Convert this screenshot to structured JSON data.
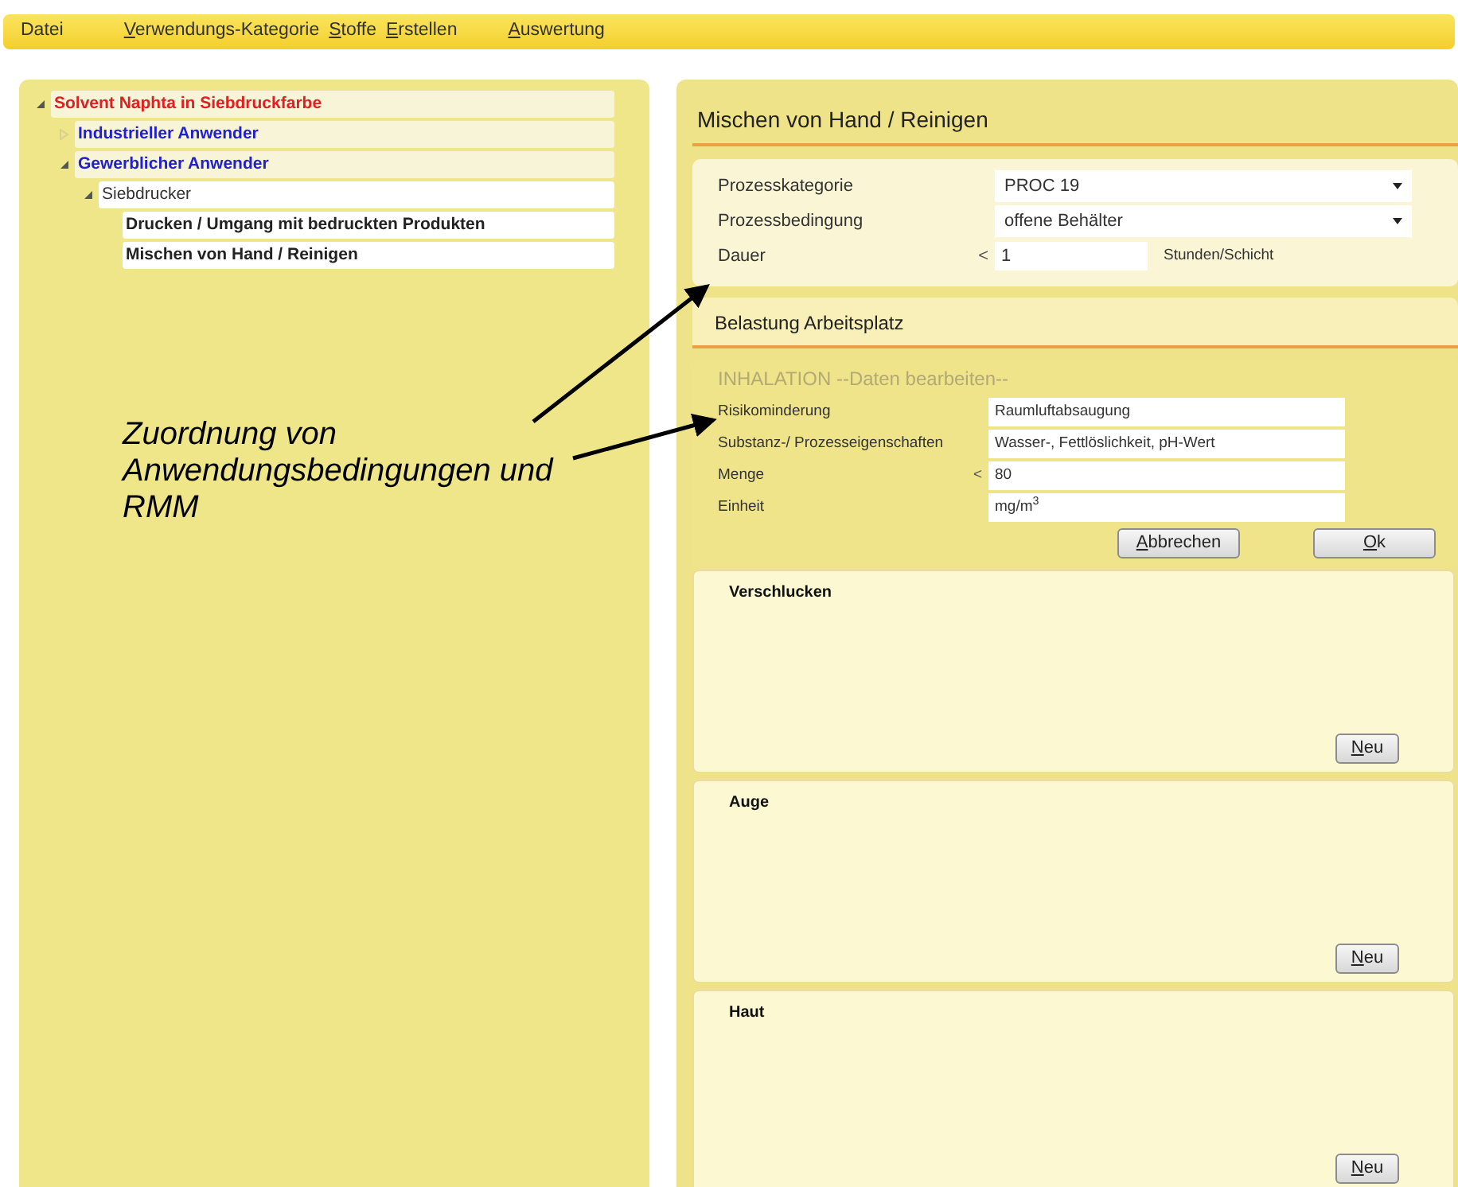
{
  "menu": [
    {
      "label": "Datei",
      "mnemonic": false
    },
    {
      "label": "Verwendungs-Kategorie",
      "mnemonic": true
    },
    {
      "label": "Stoffe",
      "mnemonic": true
    },
    {
      "label": "Erstellen",
      "mnemonic": true
    },
    {
      "label": "Auswertung",
      "mnemonic": true
    }
  ],
  "tree": [
    {
      "label": "Solvent Naphta in Siebdruckfarbe",
      "color": "#e02020",
      "bold": true,
      "expanded": true,
      "children": [
        {
          "label": "Industrieller Anwender",
          "color": "#2020d0",
          "bold": true,
          "expanded": false
        },
        {
          "label": "Gewerblicher Anwender",
          "color": "#2020d0",
          "bold": true,
          "expanded": true,
          "children": [
            {
              "label": "Siebdrucker",
              "color": "#333333",
              "bold": false,
              "expanded": true,
              "children": [
                {
                  "label": "Drucken / Umgang mit bedruckten Produkten",
                  "color": "#222222",
                  "bold": true
                },
                {
                  "label": "Mischen von Hand / Reinigen",
                  "color": "#222222",
                  "bold": true
                }
              ]
            }
          ]
        }
      ]
    }
  ],
  "annotation": {
    "text": "Zuordnung von Anwendungsbedingungen und RMM"
  },
  "detail": {
    "title": "Mischen von Hand / Reinigen",
    "fields": [
      {
        "kind": "select",
        "label": "Prozesskategorie",
        "value": "PROC 19"
      },
      {
        "kind": "select",
        "label": "Prozessbedingung",
        "value": "offene Behälter"
      },
      {
        "kind": "input",
        "label": "Dauer",
        "prefix": "<",
        "value": "1",
        "unit": "Stunden/Schicht"
      }
    ],
    "exposure": {
      "title": "Belastung Arbeitsplatz",
      "inhalation": {
        "title": "INHALATION --Daten bearbeiten--",
        "disabled": true,
        "fields": [
          {
            "kind": "input",
            "label": "Risikominderung",
            "value": "Raumluftabsaugung"
          },
          {
            "kind": "input",
            "label": "Substanz-/ Prozesseigenschaften",
            "value": "Wasser-, Fettlöslichkeit, pH-Wert"
          },
          {
            "kind": "input",
            "label": "Menge",
            "prefix": "<",
            "value": "80"
          },
          {
            "kind": "input",
            "label": "Einheit",
            "value": "mg/m$^{3}$"
          }
        ],
        "buttons": [
          {
            "label": "Abbrechen",
            "mnemonic": true
          },
          {
            "label": "Ok",
            "mnemonic": true
          }
        ]
      },
      "routes": [
        {
          "title": "Verschlucken",
          "button": {
            "label": "Neu",
            "mnemonic": true
          }
        },
        {
          "title": "Auge",
          "button": {
            "label": "Neu",
            "mnemonic": true
          }
        },
        {
          "title": "Haut",
          "button": {
            "label": "Neu",
            "mnemonic": true
          }
        }
      ]
    }
  }
}
